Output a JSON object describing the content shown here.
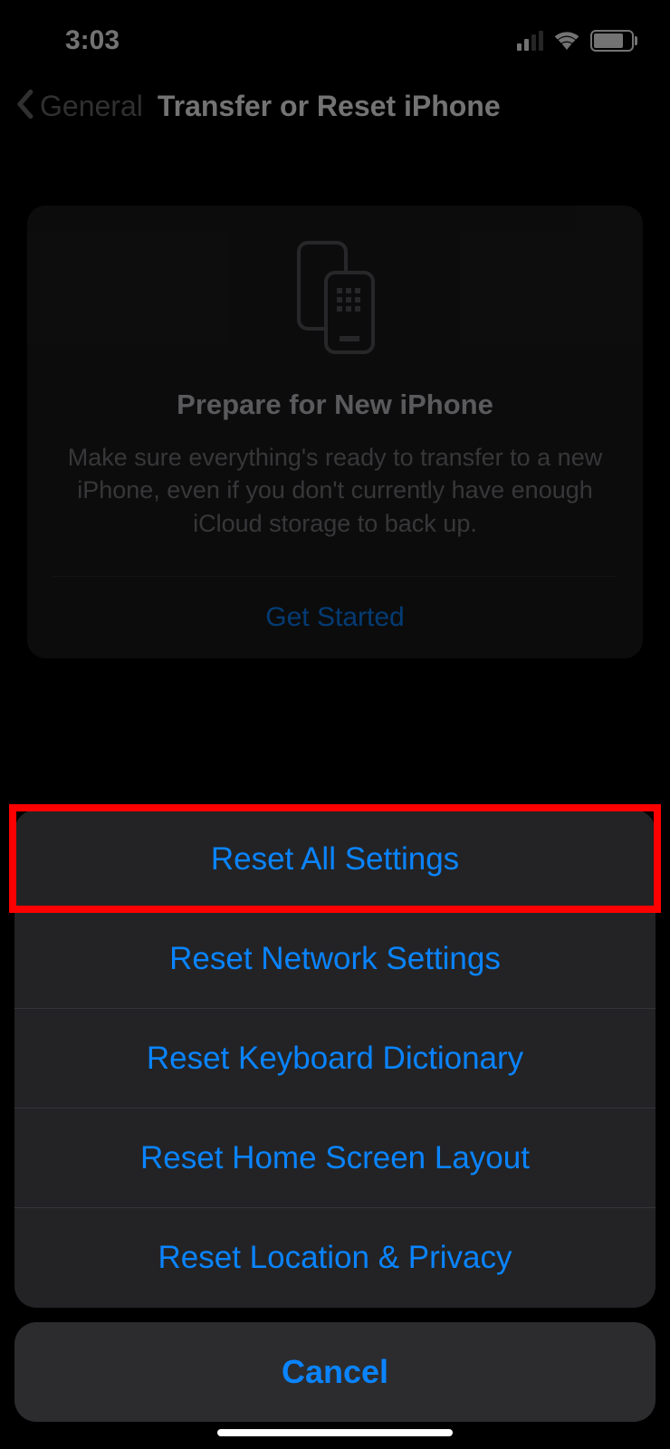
{
  "statusBar": {
    "time": "3:03"
  },
  "nav": {
    "backLabel": "General",
    "title": "Transfer or Reset iPhone"
  },
  "prepare": {
    "title": "Prepare for New iPhone",
    "description": "Make sure everything's ready to transfer to a new iPhone, even if you don't currently have enough iCloud storage to back up.",
    "cta": "Get Started"
  },
  "actionSheet": {
    "options": [
      "Reset All Settings",
      "Reset Network Settings",
      "Reset Keyboard Dictionary",
      "Reset Home Screen Layout",
      "Reset Location & Privacy"
    ],
    "cancel": "Cancel"
  }
}
